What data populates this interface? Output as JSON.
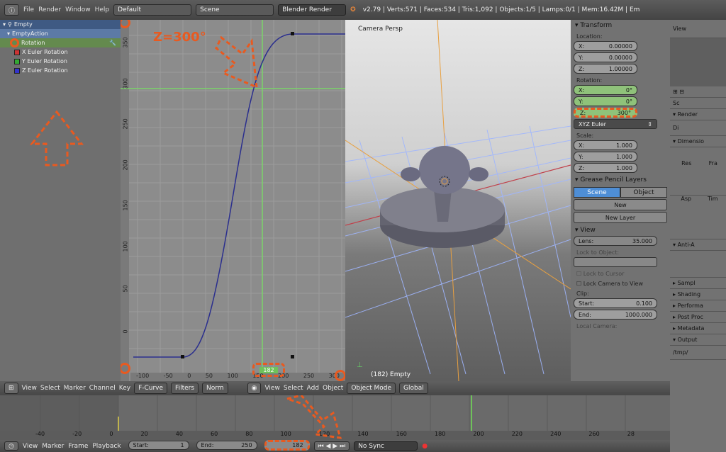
{
  "topbar": {
    "menus": [
      "File",
      "Render",
      "Window",
      "Help"
    ],
    "layout": "Default",
    "scene": "Scene",
    "engine": "Blender Render",
    "stats": "v2.79 | Verts:571 | Faces:534 | Tris:1,092 | Objects:1/5 | Lamps:0/1 | Mem:16.42M | Em"
  },
  "channels": {
    "items": [
      "Empty",
      "EmptyAction",
      "Rotation",
      "X Euler Rotation",
      "Y Euler Rotation",
      "Z Euler Rotation"
    ]
  },
  "graph": {
    "annotation": "Z=300°",
    "y_ticks": [
      "350",
      "300",
      "250",
      "200",
      "150",
      "100",
      "50",
      "0"
    ],
    "x_ticks": [
      "-100",
      "-50",
      "0",
      "50",
      "100",
      "150",
      "200",
      "250",
      "300"
    ],
    "current_frame": "182"
  },
  "view3d": {
    "label": "Camera Persp",
    "footer": "(182) Empty"
  },
  "npanel": {
    "transform": "Transform",
    "location": "Location:",
    "loc": [
      [
        "X:",
        "0.00000"
      ],
      [
        "Y:",
        "0.00000"
      ],
      [
        "Z:",
        "1.00000"
      ]
    ],
    "rotation": "Rotation:",
    "rot": [
      [
        "X:",
        "0°"
      ],
      [
        "Y:",
        "0°"
      ],
      [
        "Z:",
        "300°"
      ]
    ],
    "euler": "XYZ Euler",
    "scale": "Scale:",
    "scl": [
      [
        "X:",
        "1.000"
      ],
      [
        "Y:",
        "1.000"
      ],
      [
        "Z:",
        "1.000"
      ]
    ],
    "gp": "Grease Pencil Layers",
    "scene_tab": "Scene",
    "object_tab": "Object",
    "new_btn": "New",
    "new_layer": "New Layer",
    "view": "View",
    "lens_label": "Lens:",
    "lens": "35.000",
    "lock_obj": "Lock to Object:",
    "lock_cursor": "Lock to Cursor",
    "lock_cam": "Lock Camera to View",
    "clip": "Clip:",
    "start_label": "Start:",
    "start": "0.100",
    "end_label": "End:",
    "end": "1000.000",
    "local_cam": "Local Camera:"
  },
  "props": {
    "view": "View",
    "sc": "Sc",
    "render": "Render",
    "dimension": "Dimensio",
    "res": "Res",
    "fra": "Fra",
    "asp": "Asp",
    "tim": "Tim",
    "anti": "Anti-A",
    "items": [
      "Sampl",
      "Shading",
      "Performa",
      "Post Proc",
      "Metadata"
    ],
    "output": "Output",
    "path": "/tmp/",
    "di": "Di"
  },
  "ghead": {
    "items": [
      "View",
      "Select",
      "Marker",
      "Channel",
      "Key"
    ],
    "fcurve": "F-Curve",
    "filters": "Filters",
    "norm": "Norm",
    "v3_items": [
      "View",
      "Select",
      "Add",
      "Object"
    ],
    "mode": "Object Mode",
    "orient": "Global"
  },
  "timeline": {
    "ticks": [
      "-40",
      "-20",
      "0",
      "20",
      "40",
      "60",
      "80",
      "100",
      "120",
      "140",
      "160",
      "180",
      "200",
      "220",
      "240",
      "260",
      "28"
    ]
  },
  "tfoot": {
    "items": [
      "View",
      "Marker",
      "Frame",
      "Playback"
    ],
    "start_label": "Start:",
    "start": "1",
    "end_label": "End:",
    "end": "250",
    "frame": "182",
    "sync": "No Sync"
  }
}
